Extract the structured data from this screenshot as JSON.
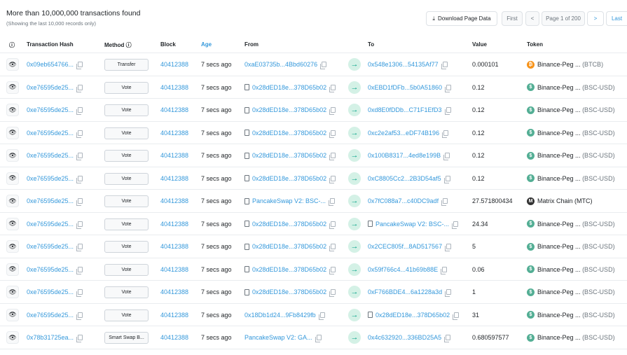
{
  "header": {
    "title": "More than 10,000,000 transactions found",
    "subtitle": "(Showing the last 10,000 records only)",
    "download_label": "Download Page Data",
    "first_label": "First",
    "prev_label": "<",
    "page_label": "Page 1 of 200",
    "next_label": ">",
    "last_label": "Last"
  },
  "columns": {
    "info": "ⓘ",
    "hash": "Transaction Hash",
    "method": "Method ⓘ",
    "block": "Block",
    "age": "Age",
    "from": "From",
    "to": "To",
    "value": "Value",
    "token": "Token"
  },
  "rows": [
    {
      "hash": "0x09eb654766...",
      "method": "Transfer",
      "block": "40412388",
      "age": "7 secs ago",
      "from": "0xaE03735b...4Bbd60276",
      "from_contract": false,
      "to": "0x548e1306...54135Af77",
      "to_contract": false,
      "value": "0.000101",
      "token": "Binance-Peg ...",
      "symbol": "(BTCB)",
      "icon": "btc"
    },
    {
      "hash": "0xe76595de25...",
      "method": "Vote",
      "block": "40412388",
      "age": "7 secs ago",
      "from": "0x28dED18e...378D65b02",
      "from_contract": true,
      "to": "0xEBD1fDFb...5b0A51860",
      "to_contract": false,
      "value": "0.12",
      "token": "Binance-Peg ...",
      "symbol": "(BSC-USD)",
      "icon": "usd"
    },
    {
      "hash": "0xe76595de25...",
      "method": "Vote",
      "block": "40412388",
      "age": "7 secs ago",
      "from": "0x28dED18e...378D65b02",
      "from_contract": true,
      "to": "0xd8E0fDDb...C71F1EfD3",
      "to_contract": false,
      "value": "0.12",
      "token": "Binance-Peg ...",
      "symbol": "(BSC-USD)",
      "icon": "usd"
    },
    {
      "hash": "0xe76595de25...",
      "method": "Vote",
      "block": "40412388",
      "age": "7 secs ago",
      "from": "0x28dED18e...378D65b02",
      "from_contract": true,
      "to": "0xc2e2af53...eDF74B196",
      "to_contract": false,
      "value": "0.12",
      "token": "Binance-Peg ...",
      "symbol": "(BSC-USD)",
      "icon": "usd"
    },
    {
      "hash": "0xe76595de25...",
      "method": "Vote",
      "block": "40412388",
      "age": "7 secs ago",
      "from": "0x28dED18e...378D65b02",
      "from_contract": true,
      "to": "0x100B8317...4ed8e199B",
      "to_contract": false,
      "value": "0.12",
      "token": "Binance-Peg ...",
      "symbol": "(BSC-USD)",
      "icon": "usd"
    },
    {
      "hash": "0xe76595de25...",
      "method": "Vote",
      "block": "40412388",
      "age": "7 secs ago",
      "from": "0x28dED18e...378D65b02",
      "from_contract": true,
      "to": "0xC8805Cc2...2B3D54af5",
      "to_contract": false,
      "value": "0.12",
      "token": "Binance-Peg ...",
      "symbol": "(BSC-USD)",
      "icon": "usd"
    },
    {
      "hash": "0xe76595de25...",
      "method": "Vote",
      "block": "40412388",
      "age": "7 secs ago",
      "from": "PancakeSwap V2: BSC-...",
      "from_contract": true,
      "to": "0x7fC088a7...c40DC9adf",
      "to_contract": false,
      "value": "27.571800434",
      "token": "Matrix Chain (MTC)",
      "symbol": "",
      "icon": "mtc"
    },
    {
      "hash": "0xe76595de25...",
      "method": "Vote",
      "block": "40412388",
      "age": "7 secs ago",
      "from": "0x28dED18e...378D65b02",
      "from_contract": true,
      "to": "PancakeSwap V2: BSC-...",
      "to_contract": true,
      "value": "24.34",
      "token": "Binance-Peg ...",
      "symbol": "(BSC-USD)",
      "icon": "usd"
    },
    {
      "hash": "0xe76595de25...",
      "method": "Vote",
      "block": "40412388",
      "age": "7 secs ago",
      "from": "0x28dED18e...378D65b02",
      "from_contract": true,
      "to": "0x2CEC805f...8AD517567",
      "to_contract": false,
      "value": "5",
      "token": "Binance-Peg ...",
      "symbol": "(BSC-USD)",
      "icon": "usd"
    },
    {
      "hash": "0xe76595de25...",
      "method": "Vote",
      "block": "40412388",
      "age": "7 secs ago",
      "from": "0x28dED18e...378D65b02",
      "from_contract": true,
      "to": "0x59f766c4...41b69b88E",
      "to_contract": false,
      "value": "0.06",
      "token": "Binance-Peg ...",
      "symbol": "(BSC-USD)",
      "icon": "usd"
    },
    {
      "hash": "0xe76595de25...",
      "method": "Vote",
      "block": "40412388",
      "age": "7 secs ago",
      "from": "0x28dED18e...378D65b02",
      "from_contract": true,
      "to": "0xF766BDE4...6a1228a3d",
      "to_contract": false,
      "value": "1",
      "token": "Binance-Peg ...",
      "symbol": "(BSC-USD)",
      "icon": "usd"
    },
    {
      "hash": "0xe76595de25...",
      "method": "Vote",
      "block": "40412388",
      "age": "7 secs ago",
      "from": "0x18Db1d24...9Fb8429fb",
      "from_contract": false,
      "to": "0x28dED18e...378D65b02",
      "to_contract": true,
      "value": "31",
      "token": "Binance-Peg ...",
      "symbol": "(BSC-USD)",
      "icon": "usd"
    },
    {
      "hash": "0x78b31725ea...",
      "method": "Smart Swap B...",
      "block": "40412388",
      "age": "7 secs ago",
      "from": "PancakeSwap V2: GA...",
      "from_contract": false,
      "to": "0x4c632920...336BD25A5",
      "to_contract": false,
      "value": "0.680597577",
      "token": "Binance-Peg ...",
      "symbol": "(BSC-USD)",
      "icon": "usd"
    }
  ]
}
